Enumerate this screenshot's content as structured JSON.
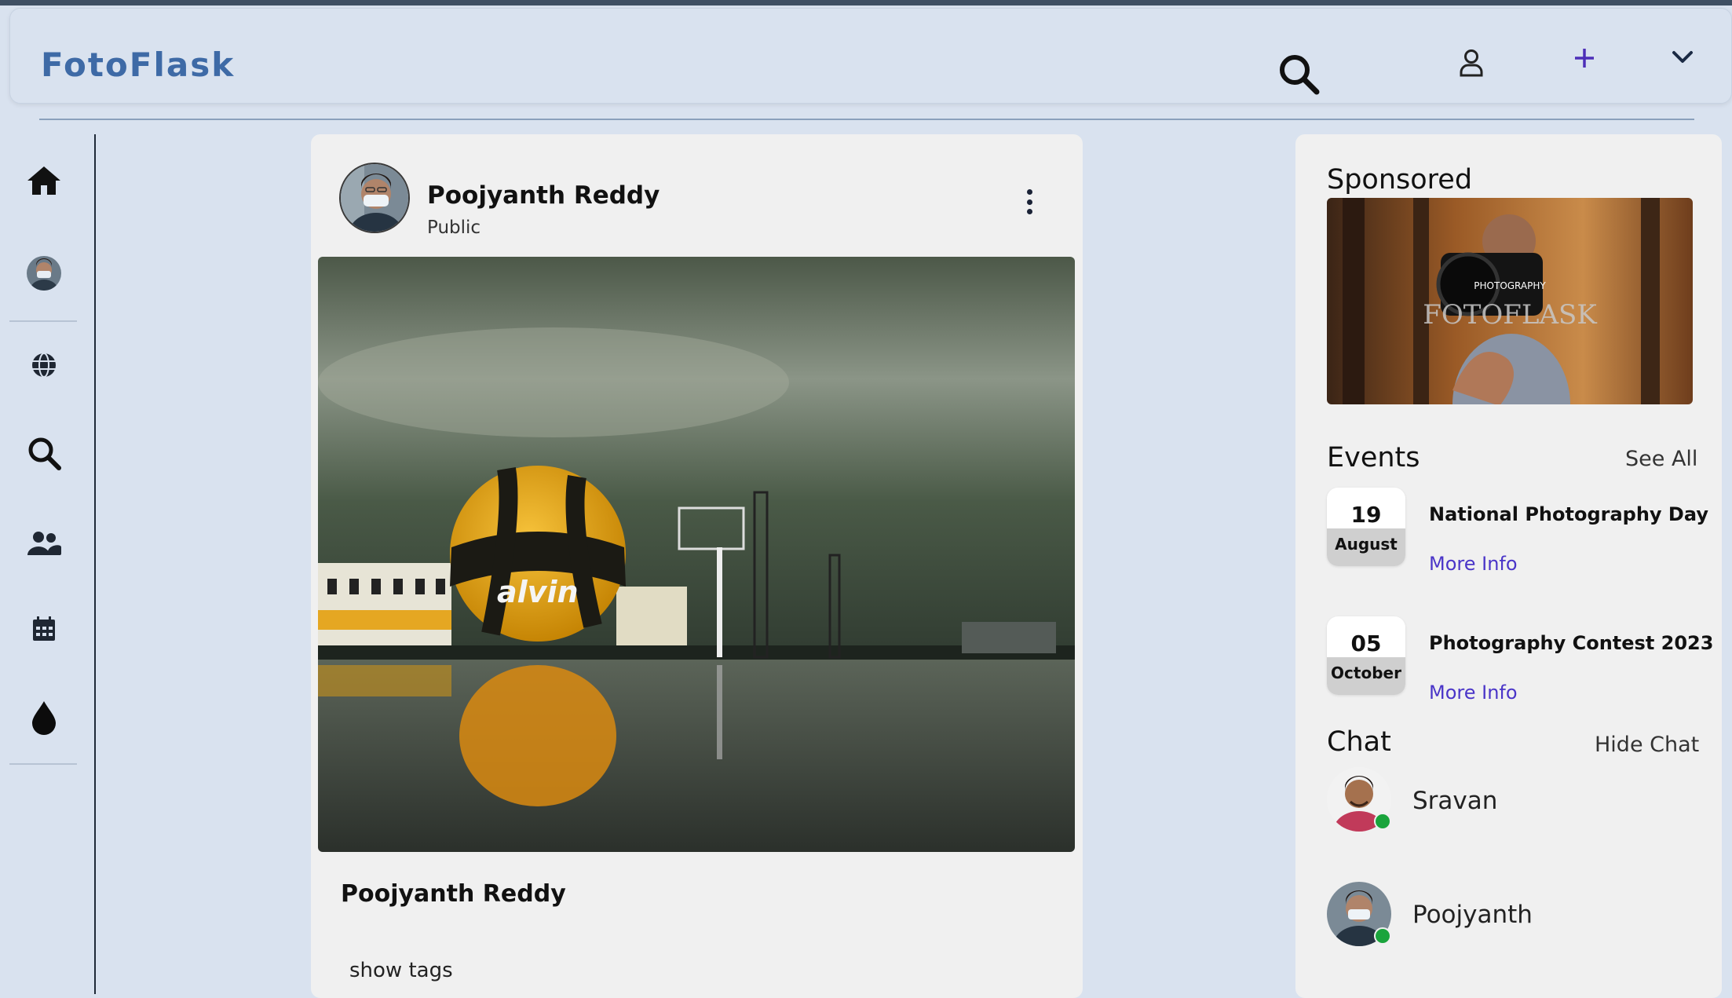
{
  "app": {
    "logo": "FotoFlask"
  },
  "header": {
    "icons": [
      "search-icon",
      "user-icon",
      "plus-icon",
      "chevron-down-icon"
    ]
  },
  "sidebar": {
    "items": [
      {
        "icon": "home-icon"
      },
      {
        "icon": "profile-avatar"
      },
      {
        "icon": "globe-icon"
      },
      {
        "icon": "search-icon"
      },
      {
        "icon": "people-icon"
      },
      {
        "icon": "calendar-icon"
      },
      {
        "icon": "drop-icon"
      }
    ]
  },
  "post": {
    "author": "Poojyanth Reddy",
    "visibility": "Public",
    "caption": "Poojyanth Reddy",
    "show_tags": "show tags",
    "image_alt_ball_text": "alvin"
  },
  "right": {
    "sponsored_title": "Sponsored",
    "ad": {
      "small": "PHOTOGRAPHY",
      "big": "FOTOFLASK"
    },
    "events_title": "Events",
    "see_all": "See All",
    "events": [
      {
        "day": "19",
        "month": "August",
        "name": "National Photography Day",
        "link": "More Info"
      },
      {
        "day": "05",
        "month": "October",
        "name": "Photography Contest 2023",
        "link": "More Info"
      }
    ],
    "chat_title": "Chat",
    "hide_chat": "Hide Chat",
    "chats": [
      {
        "name": "Sravan",
        "status": "online"
      },
      {
        "name": "Poojyanth",
        "status": "online"
      }
    ]
  },
  "colors": {
    "background": "#d9e2ef",
    "logo": "#3e6aa6",
    "link": "#4a35c8",
    "online": "#1aa43c"
  }
}
